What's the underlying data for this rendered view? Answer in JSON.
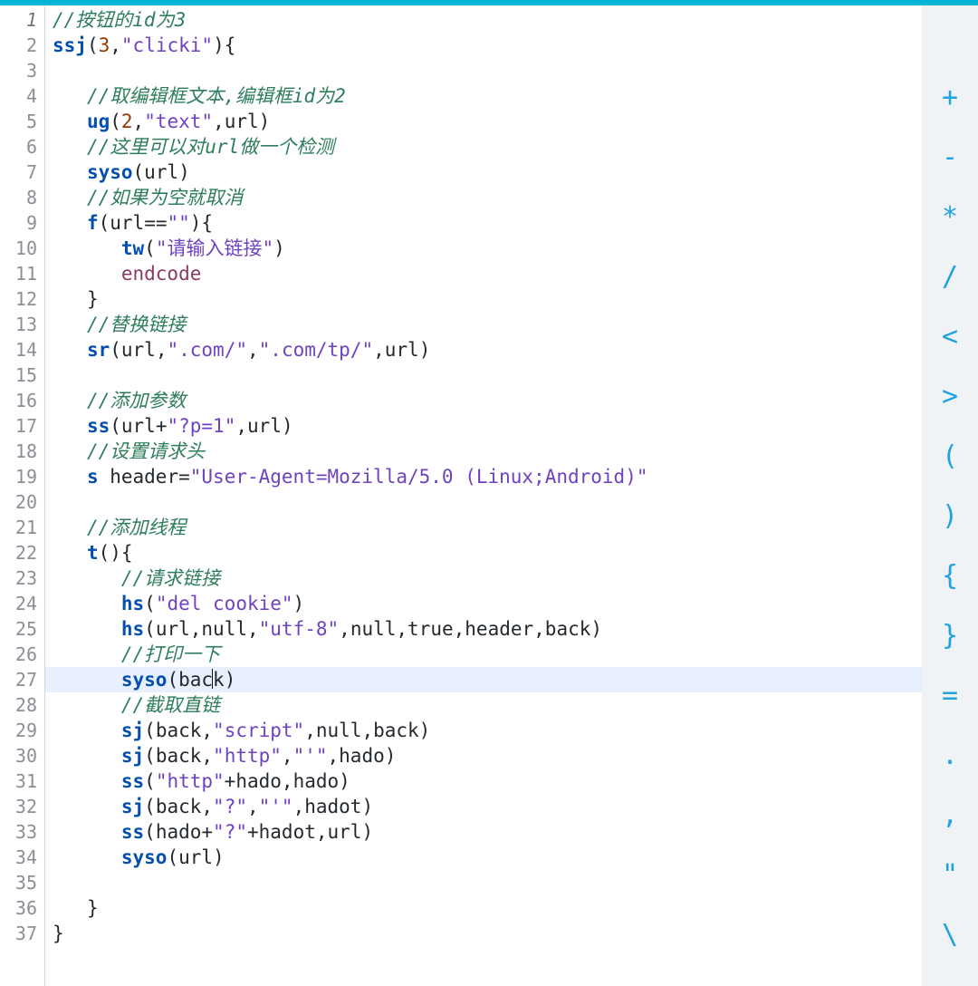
{
  "editor": {
    "current_line": 27,
    "toolbar": [
      {
        "name": "plus-icon",
        "glyph": "+"
      },
      {
        "name": "minus-icon",
        "glyph": "-"
      },
      {
        "name": "asterisk-icon",
        "glyph": "*"
      },
      {
        "name": "slash-icon",
        "glyph": "/"
      },
      {
        "name": "less-than-icon",
        "glyph": "<"
      },
      {
        "name": "greater-than-icon",
        "glyph": ">"
      },
      {
        "name": "open-paren-icon",
        "glyph": "("
      },
      {
        "name": "close-paren-icon",
        "glyph": ")"
      },
      {
        "name": "open-brace-icon",
        "glyph": "{"
      },
      {
        "name": "close-brace-icon",
        "glyph": "}"
      },
      {
        "name": "equals-icon",
        "glyph": "="
      },
      {
        "name": "dot-icon",
        "glyph": "."
      },
      {
        "name": "comma-icon",
        "glyph": ","
      },
      {
        "name": "quote-icon",
        "glyph": "\""
      },
      {
        "name": "backslash-icon",
        "glyph": "\\"
      }
    ],
    "lines": [
      {
        "n": 1,
        "indent": 0,
        "tokens": [
          {
            "t": "comment",
            "v": "//按钮的id为3"
          }
        ]
      },
      {
        "n": 2,
        "indent": 0,
        "tokens": [
          {
            "t": "fn",
            "v": "ssj"
          },
          {
            "t": "punc",
            "v": "("
          },
          {
            "t": "num",
            "v": "3"
          },
          {
            "t": "punc",
            "v": ","
          },
          {
            "t": "str",
            "v": "\"clicki\""
          },
          {
            "t": "punc",
            "v": "){"
          }
        ]
      },
      {
        "n": 3,
        "indent": 0,
        "tokens": []
      },
      {
        "n": 4,
        "indent": 1,
        "tokens": [
          {
            "t": "comment",
            "v": "//取编辑框文本,编辑框id为2"
          }
        ]
      },
      {
        "n": 5,
        "indent": 1,
        "tokens": [
          {
            "t": "fn",
            "v": "ug"
          },
          {
            "t": "punc",
            "v": "("
          },
          {
            "t": "num",
            "v": "2"
          },
          {
            "t": "punc",
            "v": ","
          },
          {
            "t": "str",
            "v": "\"text\""
          },
          {
            "t": "punc",
            "v": ","
          },
          {
            "t": "ident",
            "v": "url"
          },
          {
            "t": "punc",
            "v": ")"
          }
        ]
      },
      {
        "n": 6,
        "indent": 1,
        "tokens": [
          {
            "t": "comment",
            "v": "//这里可以对url做一个检测"
          }
        ]
      },
      {
        "n": 7,
        "indent": 1,
        "tokens": [
          {
            "t": "fn",
            "v": "syso"
          },
          {
            "t": "punc",
            "v": "("
          },
          {
            "t": "ident",
            "v": "url"
          },
          {
            "t": "punc",
            "v": ")"
          }
        ]
      },
      {
        "n": 8,
        "indent": 1,
        "tokens": [
          {
            "t": "comment",
            "v": "//如果为空就取消"
          }
        ]
      },
      {
        "n": 9,
        "indent": 1,
        "tokens": [
          {
            "t": "fn",
            "v": "f"
          },
          {
            "t": "punc",
            "v": "("
          },
          {
            "t": "ident",
            "v": "url"
          },
          {
            "t": "punc",
            "v": "=="
          },
          {
            "t": "str",
            "v": "\"\""
          },
          {
            "t": "punc",
            "v": "){"
          }
        ]
      },
      {
        "n": 10,
        "indent": 2,
        "tokens": [
          {
            "t": "fn",
            "v": "tw"
          },
          {
            "t": "punc",
            "v": "("
          },
          {
            "t": "str",
            "v": "\"请输入链接\""
          },
          {
            "t": "punc",
            "v": ")"
          }
        ]
      },
      {
        "n": 11,
        "indent": 2,
        "tokens": [
          {
            "t": "special",
            "v": "endcode"
          }
        ]
      },
      {
        "n": 12,
        "indent": 1,
        "tokens": [
          {
            "t": "punc",
            "v": "}"
          }
        ]
      },
      {
        "n": 13,
        "indent": 1,
        "tokens": [
          {
            "t": "comment",
            "v": "//替换链接"
          }
        ]
      },
      {
        "n": 14,
        "indent": 1,
        "tokens": [
          {
            "t": "fn",
            "v": "sr"
          },
          {
            "t": "punc",
            "v": "("
          },
          {
            "t": "ident",
            "v": "url"
          },
          {
            "t": "punc",
            "v": ","
          },
          {
            "t": "str",
            "v": "\".com/\""
          },
          {
            "t": "punc",
            "v": ","
          },
          {
            "t": "str",
            "v": "\".com/tp/\""
          },
          {
            "t": "punc",
            "v": ","
          },
          {
            "t": "ident",
            "v": "url"
          },
          {
            "t": "punc",
            "v": ")"
          }
        ]
      },
      {
        "n": 15,
        "indent": 0,
        "tokens": []
      },
      {
        "n": 16,
        "indent": 1,
        "tokens": [
          {
            "t": "comment",
            "v": "//添加参数"
          }
        ]
      },
      {
        "n": 17,
        "indent": 1,
        "tokens": [
          {
            "t": "fn",
            "v": "ss"
          },
          {
            "t": "punc",
            "v": "("
          },
          {
            "t": "ident",
            "v": "url"
          },
          {
            "t": "punc",
            "v": "+"
          },
          {
            "t": "str",
            "v": "\"?p=1\""
          },
          {
            "t": "punc",
            "v": ","
          },
          {
            "t": "ident",
            "v": "url"
          },
          {
            "t": "punc",
            "v": ")"
          }
        ]
      },
      {
        "n": 18,
        "indent": 1,
        "tokens": [
          {
            "t": "comment",
            "v": "//设置请求头"
          }
        ]
      },
      {
        "n": 19,
        "indent": 1,
        "tokens": [
          {
            "t": "fn",
            "v": "s"
          },
          {
            "t": "ident",
            "v": " header"
          },
          {
            "t": "punc",
            "v": "="
          },
          {
            "t": "str",
            "v": "\"User-Agent=Mozilla/5.0 (Linux;Android)\""
          }
        ]
      },
      {
        "n": 20,
        "indent": 0,
        "tokens": []
      },
      {
        "n": 21,
        "indent": 1,
        "tokens": [
          {
            "t": "comment",
            "v": "//添加线程"
          }
        ]
      },
      {
        "n": 22,
        "indent": 1,
        "tokens": [
          {
            "t": "fn",
            "v": "t"
          },
          {
            "t": "punc",
            "v": "(){"
          }
        ]
      },
      {
        "n": 23,
        "indent": 2,
        "tokens": [
          {
            "t": "comment",
            "v": "//请求链接"
          }
        ]
      },
      {
        "n": 24,
        "indent": 2,
        "tokens": [
          {
            "t": "fn",
            "v": "hs"
          },
          {
            "t": "punc",
            "v": "("
          },
          {
            "t": "str",
            "v": "\"del cookie\""
          },
          {
            "t": "punc",
            "v": ")"
          }
        ]
      },
      {
        "n": 25,
        "indent": 2,
        "tokens": [
          {
            "t": "fn",
            "v": "hs"
          },
          {
            "t": "punc",
            "v": "("
          },
          {
            "t": "ident",
            "v": "url"
          },
          {
            "t": "punc",
            "v": ","
          },
          {
            "t": "ident",
            "v": "null"
          },
          {
            "t": "punc",
            "v": ","
          },
          {
            "t": "str",
            "v": "\"utf-8\""
          },
          {
            "t": "punc",
            "v": ","
          },
          {
            "t": "ident",
            "v": "null"
          },
          {
            "t": "punc",
            "v": ","
          },
          {
            "t": "ident",
            "v": "true"
          },
          {
            "t": "punc",
            "v": ","
          },
          {
            "t": "ident",
            "v": "header"
          },
          {
            "t": "punc",
            "v": ","
          },
          {
            "t": "ident",
            "v": "back"
          },
          {
            "t": "punc",
            "v": ")"
          }
        ]
      },
      {
        "n": 26,
        "indent": 2,
        "tokens": [
          {
            "t": "comment",
            "v": "//打印一下"
          }
        ]
      },
      {
        "n": 27,
        "indent": 2,
        "tokens": [
          {
            "t": "fn",
            "v": "syso"
          },
          {
            "t": "punc",
            "v": "("
          },
          {
            "t": "ident",
            "v": "bac"
          },
          {
            "t": "caret",
            "v": ""
          },
          {
            "t": "ident",
            "v": "k"
          },
          {
            "t": "punc",
            "v": ")"
          }
        ]
      },
      {
        "n": 28,
        "indent": 2,
        "tokens": [
          {
            "t": "comment",
            "v": "//截取直链"
          }
        ]
      },
      {
        "n": 29,
        "indent": 2,
        "tokens": [
          {
            "t": "fn",
            "v": "sj"
          },
          {
            "t": "punc",
            "v": "("
          },
          {
            "t": "ident",
            "v": "back"
          },
          {
            "t": "punc",
            "v": ","
          },
          {
            "t": "str",
            "v": "\"script\""
          },
          {
            "t": "punc",
            "v": ","
          },
          {
            "t": "ident",
            "v": "null"
          },
          {
            "t": "punc",
            "v": ","
          },
          {
            "t": "ident",
            "v": "back"
          },
          {
            "t": "punc",
            "v": ")"
          }
        ]
      },
      {
        "n": 30,
        "indent": 2,
        "tokens": [
          {
            "t": "fn",
            "v": "sj"
          },
          {
            "t": "punc",
            "v": "("
          },
          {
            "t": "ident",
            "v": "back"
          },
          {
            "t": "punc",
            "v": ","
          },
          {
            "t": "str",
            "v": "\"http\""
          },
          {
            "t": "punc",
            "v": ","
          },
          {
            "t": "str",
            "v": "\"'\""
          },
          {
            "t": "punc",
            "v": ","
          },
          {
            "t": "ident",
            "v": "hado"
          },
          {
            "t": "punc",
            "v": ")"
          }
        ]
      },
      {
        "n": 31,
        "indent": 2,
        "tokens": [
          {
            "t": "fn",
            "v": "ss"
          },
          {
            "t": "punc",
            "v": "("
          },
          {
            "t": "str",
            "v": "\"http\""
          },
          {
            "t": "punc",
            "v": "+"
          },
          {
            "t": "ident",
            "v": "hado"
          },
          {
            "t": "punc",
            "v": ","
          },
          {
            "t": "ident",
            "v": "hado"
          },
          {
            "t": "punc",
            "v": ")"
          }
        ]
      },
      {
        "n": 32,
        "indent": 2,
        "tokens": [
          {
            "t": "fn",
            "v": "sj"
          },
          {
            "t": "punc",
            "v": "("
          },
          {
            "t": "ident",
            "v": "back"
          },
          {
            "t": "punc",
            "v": ","
          },
          {
            "t": "str",
            "v": "\"?\""
          },
          {
            "t": "punc",
            "v": ","
          },
          {
            "t": "str",
            "v": "\"'\""
          },
          {
            "t": "punc",
            "v": ","
          },
          {
            "t": "ident",
            "v": "hadot"
          },
          {
            "t": "punc",
            "v": ")"
          }
        ]
      },
      {
        "n": 33,
        "indent": 2,
        "tokens": [
          {
            "t": "fn",
            "v": "ss"
          },
          {
            "t": "punc",
            "v": "("
          },
          {
            "t": "ident",
            "v": "hado"
          },
          {
            "t": "punc",
            "v": "+"
          },
          {
            "t": "str",
            "v": "\"?\""
          },
          {
            "t": "punc",
            "v": "+"
          },
          {
            "t": "ident",
            "v": "hadot"
          },
          {
            "t": "punc",
            "v": ","
          },
          {
            "t": "ident",
            "v": "url"
          },
          {
            "t": "punc",
            "v": ")"
          }
        ]
      },
      {
        "n": 34,
        "indent": 2,
        "tokens": [
          {
            "t": "fn",
            "v": "syso"
          },
          {
            "t": "punc",
            "v": "("
          },
          {
            "t": "ident",
            "v": "url"
          },
          {
            "t": "punc",
            "v": ")"
          }
        ]
      },
      {
        "n": 35,
        "indent": 0,
        "tokens": []
      },
      {
        "n": 36,
        "indent": 1,
        "tokens": [
          {
            "t": "punc",
            "v": "}"
          }
        ]
      },
      {
        "n": 37,
        "indent": 0,
        "tokens": [
          {
            "t": "punc",
            "v": "}"
          }
        ]
      }
    ]
  }
}
